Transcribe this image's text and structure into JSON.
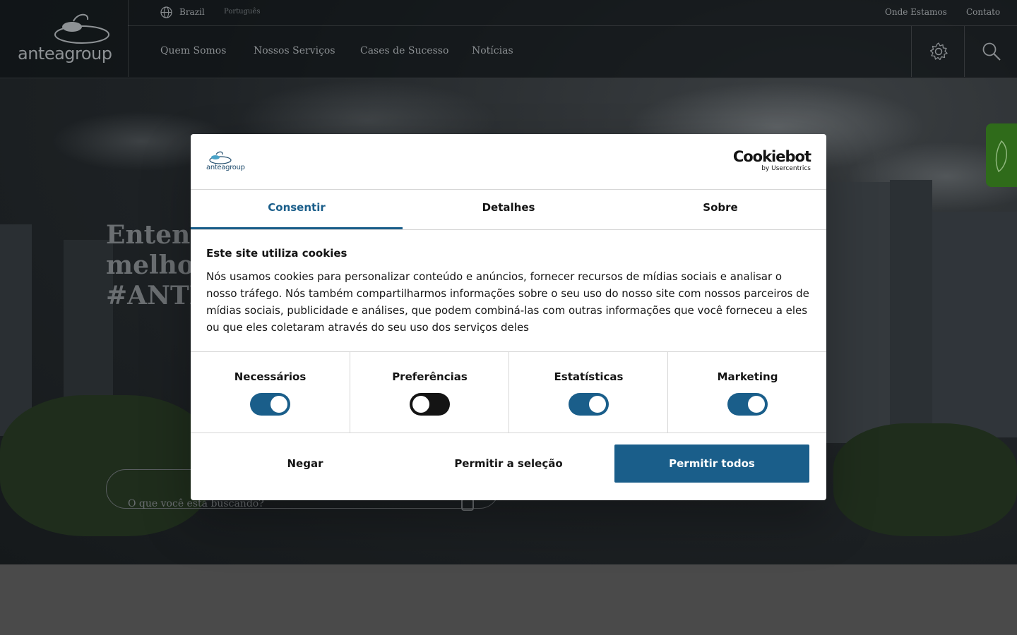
{
  "header": {
    "logo_text": "anteagroup",
    "country": "Brazil",
    "language": "Português",
    "top_links": [
      "Onde Estamos",
      "Contato"
    ],
    "nav": [
      "Quem Somos",
      "Nossos Serviços",
      "Cases de Sucesso",
      "Notícias"
    ]
  },
  "hero": {
    "title_lines": [
      "Entend",
      "melhor",
      "#ANTE"
    ],
    "search_placeholder": "O que você está buscando?"
  },
  "cookie": {
    "logo_text": "anteagroup",
    "brand_name": "Cookiebot",
    "brand_sub": "by Usercentrics",
    "tabs": [
      "Consentir",
      "Detalhes",
      "Sobre"
    ],
    "active_tab": "Consentir",
    "heading": "Este site utiliza cookies",
    "body": "Nós usamos cookies para personalizar conteúdo e anúncios, fornecer recursos de mídias sociais e analisar o nosso tráfego. Nós também compartilharmos informações sobre o seu uso do nosso site com nossos parceiros de mídias sociais, publicidade e análises, que podem combiná-las com outras informações que você forneceu a eles ou que eles coletaram através do seu uso dos serviços deles",
    "categories": [
      {
        "label": "Necessários",
        "enabled": true
      },
      {
        "label": "Preferências",
        "enabled": false
      },
      {
        "label": "Estatísticas",
        "enabled": true
      },
      {
        "label": "Marketing",
        "enabled": true
      }
    ],
    "buttons": {
      "deny": "Negar",
      "allow_selection": "Permitir a seleção",
      "allow_all": "Permitir todos"
    },
    "accent_color": "#1a5e8a"
  }
}
